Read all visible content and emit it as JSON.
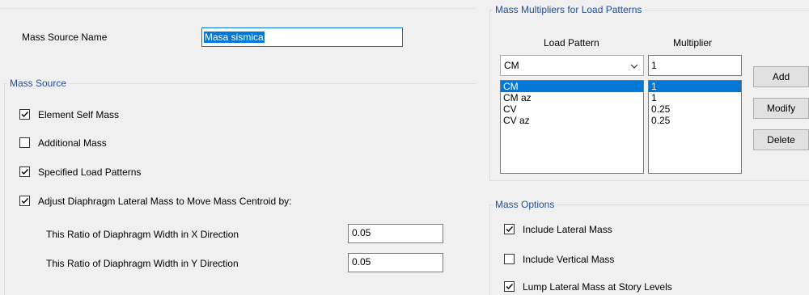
{
  "left": {
    "mass_source_name_label": "Mass Source Name",
    "mass_source_name_value": "Masa sismica",
    "mass_source_group_title": "Mass Source",
    "options": [
      {
        "label": "Element Self Mass",
        "checked": true
      },
      {
        "label": "Additional Mass",
        "checked": false
      },
      {
        "label": "Specified Load Patterns",
        "checked": true
      },
      {
        "label": "Adjust Diaphragm Lateral Mass to Move Mass Centroid by:",
        "checked": true
      }
    ],
    "ratio_x_label": "This Ratio of Diaphragm Width in X Direction",
    "ratio_x_value": "0.05",
    "ratio_y_label": "This Ratio of Diaphragm Width in Y Direction",
    "ratio_y_value": "0.05"
  },
  "right": {
    "multipliers_group_title": "Mass Multipliers for Load Patterns",
    "col_load_pattern": "Load Pattern",
    "col_multiplier": "Multiplier",
    "load_pattern_selected": "CM",
    "multiplier_value": "1",
    "rows": [
      {
        "pattern": "CM",
        "multiplier": "1",
        "selected": true
      },
      {
        "pattern": "CM az",
        "multiplier": "1",
        "selected": false
      },
      {
        "pattern": "CV",
        "multiplier": "0.25",
        "selected": false
      },
      {
        "pattern": "CV az",
        "multiplier": "0.25",
        "selected": false
      }
    ],
    "buttons": {
      "add": "Add",
      "modify": "Modify",
      "delete": "Delete"
    },
    "mass_options_title": "Mass Options",
    "mass_options": [
      {
        "label": "Include Lateral Mass",
        "checked": true
      },
      {
        "label": "Include Vertical Mass",
        "checked": false
      },
      {
        "label": "Lump Lateral Mass at Story Levels",
        "checked": true
      }
    ]
  },
  "colors": {
    "group_title": "#1f4e9e",
    "selection": "#0078d7",
    "name_field_border": "#0078d7"
  },
  "icons": [
    "checkmark-icon",
    "chevron-down-icon"
  ]
}
